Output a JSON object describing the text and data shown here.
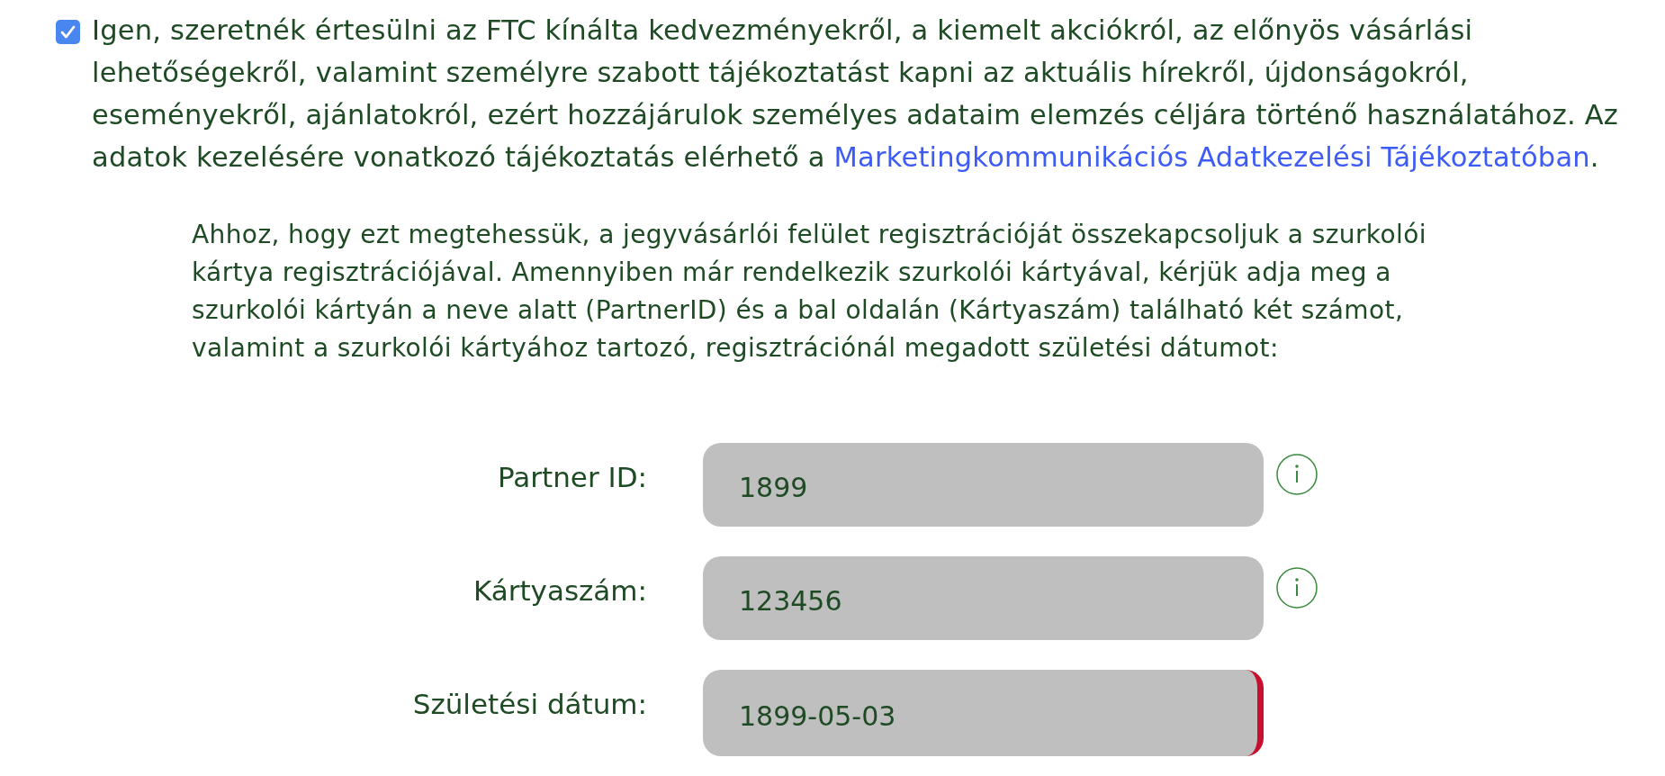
{
  "consent": {
    "checked": true,
    "text": "Igen, szeretnék értesülni az FTC kínálta kedvezményekről, a kiemelt akciókról, az előnyös vásárlási lehetőségekről, valamint személyre szabott tájékoztatást kapni az aktuális hírekről, újdonságokról, eseményekről, ajánlatokról, ezért hozzájárulok személyes adataim elemzés céljára történő használatához. Az adatok kezelésére vonatkozó tájékoztatás elérhető a ",
    "link": "Marketingkommunikációs Adatkezelési Tájékoztatóban",
    "text_end": "."
  },
  "instructions": "Ahhoz, hogy ezt megtehessük, a jegyvásárlói felület regisztrációját összekapcsoljuk a szurkolói kártya regisztrációjával. Amennyiben már rendelkezik szurkolói kártyával, kérjük adja meg a szurkolói kártyán a neve alatt (PartnerID) és a bal oldalán (Kártyaszám) található két számot, valamint a szurkolói kártyához tartozó, regisztrációnál megadott születési dátumot:",
  "fields": [
    {
      "label": "Partner ID:",
      "value": "1899",
      "info": true,
      "invalid": false
    },
    {
      "label": "Kártyaszám:",
      "value": "123456",
      "info": true,
      "invalid": false
    },
    {
      "label": "Születési dátum:",
      "value": "1899-05-03",
      "info": false,
      "invalid": true
    }
  ]
}
